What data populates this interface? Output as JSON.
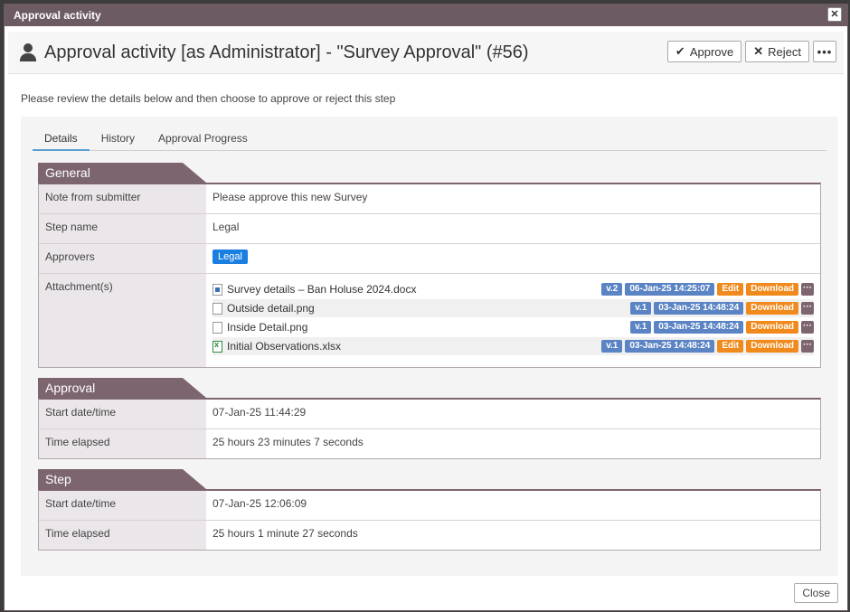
{
  "window": {
    "title": "Approval activity"
  },
  "header": {
    "title": "Approval activity [as Administrator] - \"Survey Approval\" (#56)",
    "approve_label": "Approve",
    "reject_label": "Reject",
    "more_label": "•••"
  },
  "instructions": "Please review the details below and then choose to approve or reject this step",
  "tabs": [
    {
      "label": "Details"
    },
    {
      "label": "History"
    },
    {
      "label": "Approval Progress"
    }
  ],
  "general": {
    "title": "General",
    "note_label": "Note from submitter",
    "note_value": "Please approve this new Survey",
    "step_label": "Step name",
    "step_value": "Legal",
    "approvers_label": "Approvers",
    "approvers_value": "Legal",
    "attachments_label": "Attachment(s)",
    "attachments": [
      {
        "name": "Survey details – Ban Holuse 2024.docx",
        "version": "v.2",
        "date": "06-Jan-25 14:25:07",
        "edit": "Edit",
        "download": "Download",
        "icon": "word-file-icon"
      },
      {
        "name": "Outside detail.png",
        "version": "v.1",
        "date": "03-Jan-25 14:48:24",
        "download": "Download",
        "icon": "image-file-icon"
      },
      {
        "name": "Inside Detail.png",
        "version": "v.1",
        "date": "03-Jan-25 14:48:24",
        "download": "Download",
        "icon": "image-file-icon"
      },
      {
        "name": "Initial Observations.xlsx",
        "version": "v.1",
        "date": "03-Jan-25 14:48:24",
        "edit": "Edit",
        "download": "Download",
        "icon": "excel-file-icon"
      }
    ]
  },
  "approval": {
    "title": "Approval",
    "start_label": "Start date/time",
    "start_value": "07-Jan-25 11:44:29",
    "elapsed_label": "Time elapsed",
    "elapsed_value": "25 hours 23 minutes 7 seconds"
  },
  "step": {
    "title": "Step",
    "start_label": "Start date/time",
    "start_value": "07-Jan-25 12:06:09",
    "elapsed_label": "Time elapsed",
    "elapsed_value": "25 hours 1 minute 27 seconds"
  },
  "footer": {
    "close_label": "Close"
  },
  "colors": {
    "accent": "#7d6570",
    "badge_blue": "#5b84c4",
    "badge_orange": "#f08a1c",
    "tag_blue": "#1a7fe0"
  }
}
